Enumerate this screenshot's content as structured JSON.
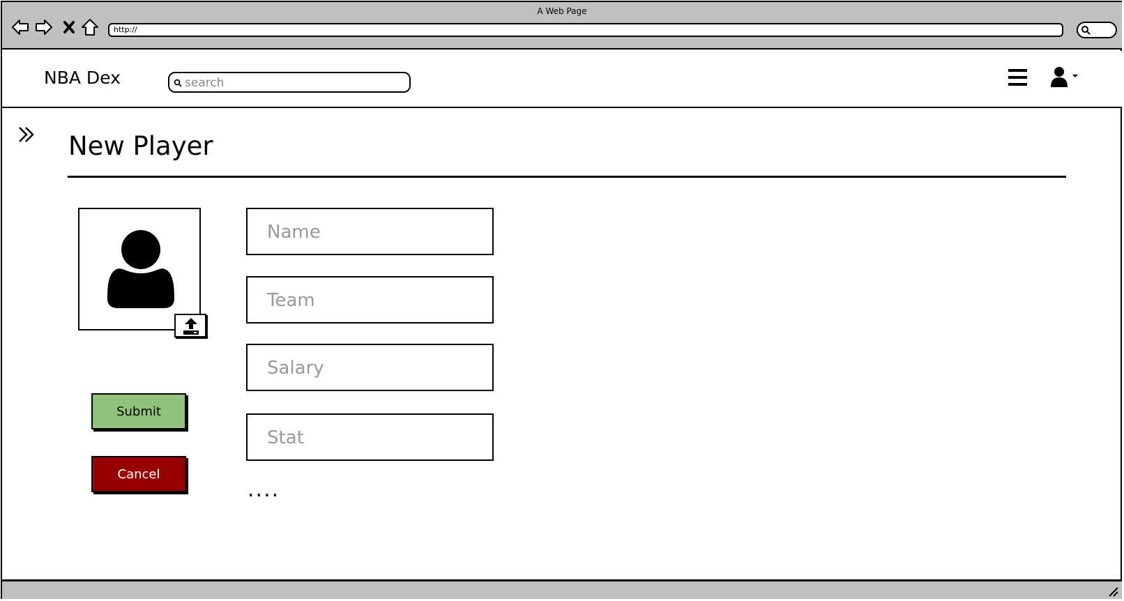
{
  "window": {
    "title": "A Web Page"
  },
  "browser": {
    "back_icon": "back-arrow-icon",
    "forward_icon": "forward-arrow-icon",
    "stop_icon": "close-icon",
    "home_icon": "home-icon",
    "url": "http://",
    "search_icon": "search-icon"
  },
  "header": {
    "brand": "NBA Dex",
    "search_placeholder": "search",
    "menu_icon": "hamburger-menu-icon",
    "user_icon": "user-dropdown-icon"
  },
  "page": {
    "title": "New Player",
    "avatar_icon": "user-avatar-icon",
    "upload_icon": "upload-icon",
    "submit_label": "Submit",
    "cancel_label": "Cancel",
    "fields": {
      "name_placeholder": "Name",
      "team_placeholder": "Team",
      "salary_placeholder": "Salary",
      "stat_placeholder": "Stat"
    },
    "more_indicator": "...."
  },
  "colors": {
    "chrome": "#c0c0c0",
    "submit": "#8fc27a",
    "cancel": "#990000"
  }
}
